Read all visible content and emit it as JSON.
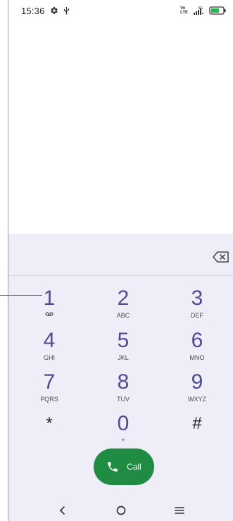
{
  "status_bar": {
    "time": "15:36",
    "volte_top": "Vo",
    "volte_bottom": "LTE",
    "network": "4G"
  },
  "dialer": {
    "digits": "",
    "keys": [
      {
        "number": "1",
        "letters": ""
      },
      {
        "number": "2",
        "letters": "ABC"
      },
      {
        "number": "3",
        "letters": "DEF"
      },
      {
        "number": "4",
        "letters": "GHI"
      },
      {
        "number": "5",
        "letters": "JKL"
      },
      {
        "number": "6",
        "letters": "MNO"
      },
      {
        "number": "7",
        "letters": "PQRS"
      },
      {
        "number": "8",
        "letters": "TUV"
      },
      {
        "number": "9",
        "letters": "WXYZ"
      },
      {
        "number": "*",
        "letters": ""
      },
      {
        "number": "0",
        "letters": "+"
      },
      {
        "number": "#",
        "letters": ""
      }
    ],
    "call_label": "Call"
  },
  "icons": {
    "settings": "gear-icon",
    "usb": "usb-icon",
    "signal": "signal-bars-icon",
    "battery": "battery-icon",
    "backspace": "backspace-icon",
    "voicemail": "voicemail-icon",
    "phone": "phone-icon",
    "back": "back-icon",
    "home": "home-icon",
    "recents": "recents-icon"
  },
  "colors": {
    "call_button": "#1f8b43",
    "keypad_background": "#efedf8",
    "key_number": "#4f4a94",
    "annotation_line": "#d8374e"
  }
}
